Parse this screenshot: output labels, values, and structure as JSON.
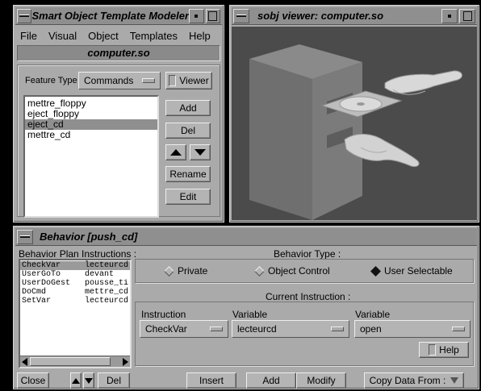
{
  "modeler": {
    "title": "Smart Object Template Modeler",
    "menu": [
      "File",
      "Visual",
      "Object",
      "Templates",
      "Help"
    ],
    "object_name": "computer.so",
    "feature_type_label": "Feature Type :",
    "feature_type_value": "Commands",
    "viewer_label": "Viewer",
    "commands": [
      "mettre_floppy",
      "eject_floppy",
      "eject_cd",
      "mettre_cd"
    ],
    "selected_command": "eject_cd",
    "add_label": "Add",
    "del_label": "Del",
    "rename_label": "Rename",
    "edit_label": "Edit"
  },
  "viewer": {
    "title": "sobj viewer: computer.so"
  },
  "behavior": {
    "title": "Behavior [push_cd]",
    "plan_label": "Behavior Plan Instructions :",
    "plan_rows": [
      {
        "cmd": "CheckVar",
        "arg": "lecteurcd"
      },
      {
        "cmd": "UserGoTo",
        "arg": "devant"
      },
      {
        "cmd": "UserDoGest",
        "arg": "pousse_tir"
      },
      {
        "cmd": "DoCmd",
        "arg": "mettre_cd"
      },
      {
        "cmd": "SetVar",
        "arg": "lecteurcd"
      }
    ],
    "type_label": "Behavior Type :",
    "type_options": [
      "Private",
      "Object Control",
      "User Selectable"
    ],
    "type_selected": "User Selectable",
    "current_label": "Current Instruction :",
    "instruction_label": "Instruction",
    "instruction_value": "CheckVar",
    "variable1_label": "Variable",
    "variable1_value": "lecteurcd",
    "variable2_label": "Variable",
    "variable2_value": "open",
    "help_label": "Help",
    "close_label": "Close",
    "del_label": "Del",
    "insert_label": "Insert",
    "add_label": "Add",
    "modify_label": "Modify",
    "copy_label": "Copy Data From :"
  }
}
